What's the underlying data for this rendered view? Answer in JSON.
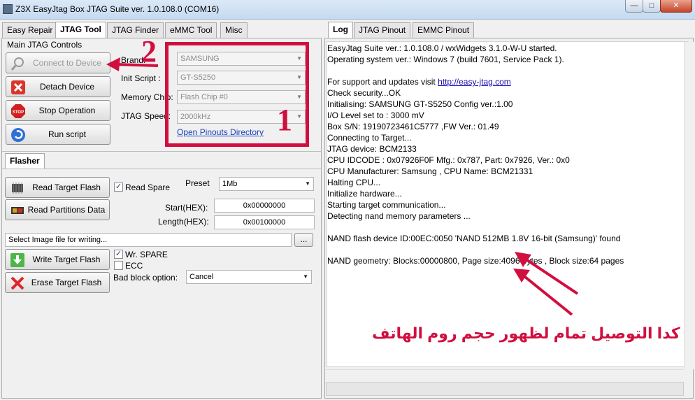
{
  "window": {
    "title": "Z3X EasyJtag Box JTAG Suite ver. 1.0.108.0 (COM16)",
    "min_symbol": "—",
    "max_symbol": "□",
    "close_symbol": "✕"
  },
  "left_tabs": [
    "Easy Repair",
    "JTAG Tool",
    "JTAG Finder",
    "eMMC Tool",
    "Misc"
  ],
  "right_tabs": [
    "Log",
    "JTAG Pinout",
    "EMMC Pinout"
  ],
  "jtag_controls": {
    "section_title": "Main JTAG Controls",
    "connect_label": "Connect to Device",
    "detach_label": "Detach Device",
    "stop_label": "Stop Operation",
    "stop_icon_text": "STOP",
    "run_label": "Run script",
    "brand_label": "Brand:",
    "brand_value": "SAMSUNG",
    "init_label": "Init Script :",
    "init_value": "GT-S5250",
    "memory_label": "Memory Chip:",
    "memory_value": "Flash Chip #0",
    "speed_label": "JTAG Speed:",
    "speed_value": "2000kHz",
    "pinouts_link": "Open Pinouts Directory"
  },
  "flasher": {
    "tab_label": "Flasher",
    "read_flash_label": "Read Target Flash",
    "read_partitions_label": "Read Partitions Data",
    "read_spare_label": "Read Spare",
    "read_spare_checked": true,
    "preset_label": "Preset",
    "preset_value": "1Mb",
    "start_label": "Start(HEX):",
    "start_value": "0x00000000",
    "length_label": "Length(HEX):",
    "length_value": "0x00100000",
    "image_placeholder": "Select Image file for writing...",
    "browse_label": "...",
    "write_label": "Write Target Flash",
    "erase_label": "Erase Target Flash",
    "wr_spare_label": "Wr. SPARE",
    "wr_spare_checked": true,
    "ecc_label": "ECC",
    "ecc_checked": false,
    "bad_block_label": "Bad block option:",
    "bad_block_value": "Cancel"
  },
  "log_lines": [
    "EasyJtag Suite ver.: 1.0.108.0 / wxWidgets 3.1.0-W-U started.",
    "Operating system ver.: Windows 7 (build 7601, Service Pack 1).",
    "",
    "Check security...OK",
    "Initialising: SAMSUNG GT-S5250 Config ver.:1.00",
    "I/O Level set to : 3000 mV",
    "Box S/N: 19190723461C5777 ,FW Ver.: 01.49",
    "Connecting to Target...",
    "JTAG device: BCM2133",
    "CPU IDCODE : 0x07926F0F Mfg.: 0x787, Part: 0x7926, Ver.: 0x0",
    "CPU Manufacturer: Samsung , CPU Name: BCM21331",
    "Halting CPU...",
    "Initialize hardware...",
    "Starting target communication...",
    "Detecting nand memory parameters ...",
    "",
    "NAND flash device ID:00EC:0050 'NAND 512MB 1.8V 16-bit (Samsung)' found",
    "",
    "NAND geometry: Blocks:00000800, Page size:4096 bytes , Block size:64 pages"
  ],
  "support_text": "For support and updates visit ",
  "support_link": "http://easy-jtag.com",
  "annotations": {
    "num1": "1",
    "num2": "2",
    "arabic_text": "كدا التوصيل تمام لظهور حجم روم الهاتف",
    "color": "#d10f3f"
  }
}
